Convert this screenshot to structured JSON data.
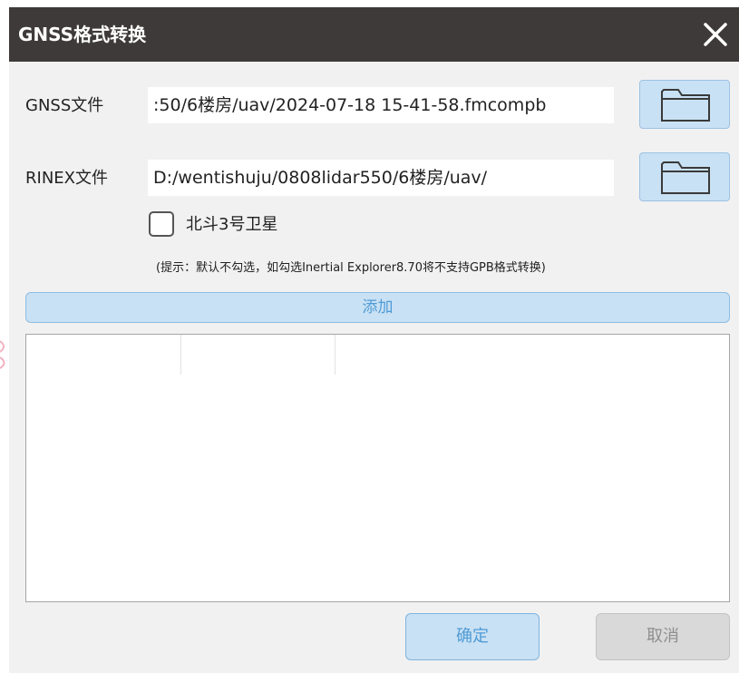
{
  "window": {
    "title": "GNSS格式转换",
    "close_icon": "close-icon"
  },
  "gnss": {
    "label": "GNSS文件",
    "value": ":50/6楼房/uav/2024-07-18 15-41-58.fmcompb",
    "browse_icon": "folder-icon"
  },
  "rinex": {
    "label": "RINEX文件",
    "value": "D:/wentishuju/0808lidar550/6楼房/uav/",
    "browse_icon": "folder-icon"
  },
  "beidou": {
    "label": "北斗3号卫星",
    "checked": false
  },
  "hint": "(提示：默认不勾选，如勾选Inertial Explorer8.70将不支持GPB格式转换)",
  "add_button": "添加",
  "file_list": {
    "rows": []
  },
  "footer": {
    "ok_label": "确定",
    "cancel_label": "取消"
  },
  "colors": {
    "titlebar": "#3e3a39",
    "accent_button": "#c9e1f4",
    "accent_text": "#4e9bd6",
    "disabled_button": "#d9d9d9"
  }
}
